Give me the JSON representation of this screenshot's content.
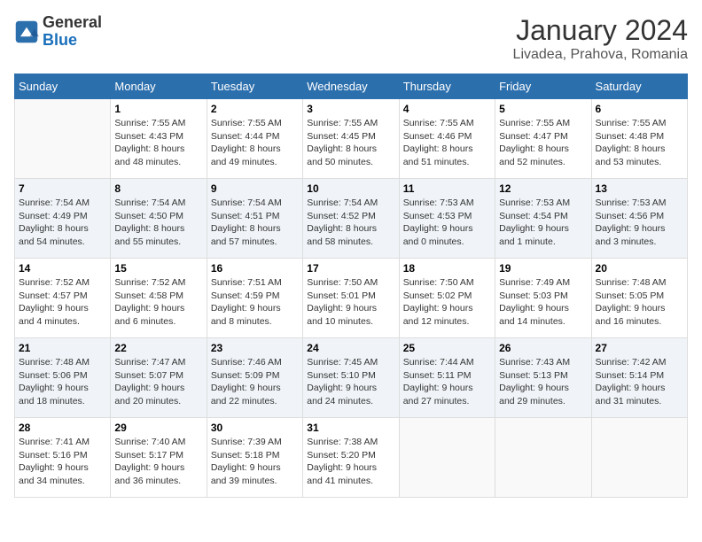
{
  "header": {
    "logo_line1": "General",
    "logo_line2": "Blue",
    "title": "January 2024",
    "subtitle": "Livadea, Prahova, Romania"
  },
  "days_of_week": [
    "Sunday",
    "Monday",
    "Tuesday",
    "Wednesday",
    "Thursday",
    "Friday",
    "Saturday"
  ],
  "weeks": [
    [
      {
        "day": "",
        "info": ""
      },
      {
        "day": "1",
        "info": "Sunrise: 7:55 AM\nSunset: 4:43 PM\nDaylight: 8 hours\nand 48 minutes."
      },
      {
        "day": "2",
        "info": "Sunrise: 7:55 AM\nSunset: 4:44 PM\nDaylight: 8 hours\nand 49 minutes."
      },
      {
        "day": "3",
        "info": "Sunrise: 7:55 AM\nSunset: 4:45 PM\nDaylight: 8 hours\nand 50 minutes."
      },
      {
        "day": "4",
        "info": "Sunrise: 7:55 AM\nSunset: 4:46 PM\nDaylight: 8 hours\nand 51 minutes."
      },
      {
        "day": "5",
        "info": "Sunrise: 7:55 AM\nSunset: 4:47 PM\nDaylight: 8 hours\nand 52 minutes."
      },
      {
        "day": "6",
        "info": "Sunrise: 7:55 AM\nSunset: 4:48 PM\nDaylight: 8 hours\nand 53 minutes."
      }
    ],
    [
      {
        "day": "7",
        "info": "Sunrise: 7:54 AM\nSunset: 4:49 PM\nDaylight: 8 hours\nand 54 minutes."
      },
      {
        "day": "8",
        "info": "Sunrise: 7:54 AM\nSunset: 4:50 PM\nDaylight: 8 hours\nand 55 minutes."
      },
      {
        "day": "9",
        "info": "Sunrise: 7:54 AM\nSunset: 4:51 PM\nDaylight: 8 hours\nand 57 minutes."
      },
      {
        "day": "10",
        "info": "Sunrise: 7:54 AM\nSunset: 4:52 PM\nDaylight: 8 hours\nand 58 minutes."
      },
      {
        "day": "11",
        "info": "Sunrise: 7:53 AM\nSunset: 4:53 PM\nDaylight: 9 hours\nand 0 minutes."
      },
      {
        "day": "12",
        "info": "Sunrise: 7:53 AM\nSunset: 4:54 PM\nDaylight: 9 hours\nand 1 minute."
      },
      {
        "day": "13",
        "info": "Sunrise: 7:53 AM\nSunset: 4:56 PM\nDaylight: 9 hours\nand 3 minutes."
      }
    ],
    [
      {
        "day": "14",
        "info": "Sunrise: 7:52 AM\nSunset: 4:57 PM\nDaylight: 9 hours\nand 4 minutes."
      },
      {
        "day": "15",
        "info": "Sunrise: 7:52 AM\nSunset: 4:58 PM\nDaylight: 9 hours\nand 6 minutes."
      },
      {
        "day": "16",
        "info": "Sunrise: 7:51 AM\nSunset: 4:59 PM\nDaylight: 9 hours\nand 8 minutes."
      },
      {
        "day": "17",
        "info": "Sunrise: 7:50 AM\nSunset: 5:01 PM\nDaylight: 9 hours\nand 10 minutes."
      },
      {
        "day": "18",
        "info": "Sunrise: 7:50 AM\nSunset: 5:02 PM\nDaylight: 9 hours\nand 12 minutes."
      },
      {
        "day": "19",
        "info": "Sunrise: 7:49 AM\nSunset: 5:03 PM\nDaylight: 9 hours\nand 14 minutes."
      },
      {
        "day": "20",
        "info": "Sunrise: 7:48 AM\nSunset: 5:05 PM\nDaylight: 9 hours\nand 16 minutes."
      }
    ],
    [
      {
        "day": "21",
        "info": "Sunrise: 7:48 AM\nSunset: 5:06 PM\nDaylight: 9 hours\nand 18 minutes."
      },
      {
        "day": "22",
        "info": "Sunrise: 7:47 AM\nSunset: 5:07 PM\nDaylight: 9 hours\nand 20 minutes."
      },
      {
        "day": "23",
        "info": "Sunrise: 7:46 AM\nSunset: 5:09 PM\nDaylight: 9 hours\nand 22 minutes."
      },
      {
        "day": "24",
        "info": "Sunrise: 7:45 AM\nSunset: 5:10 PM\nDaylight: 9 hours\nand 24 minutes."
      },
      {
        "day": "25",
        "info": "Sunrise: 7:44 AM\nSunset: 5:11 PM\nDaylight: 9 hours\nand 27 minutes."
      },
      {
        "day": "26",
        "info": "Sunrise: 7:43 AM\nSunset: 5:13 PM\nDaylight: 9 hours\nand 29 minutes."
      },
      {
        "day": "27",
        "info": "Sunrise: 7:42 AM\nSunset: 5:14 PM\nDaylight: 9 hours\nand 31 minutes."
      }
    ],
    [
      {
        "day": "28",
        "info": "Sunrise: 7:41 AM\nSunset: 5:16 PM\nDaylight: 9 hours\nand 34 minutes."
      },
      {
        "day": "29",
        "info": "Sunrise: 7:40 AM\nSunset: 5:17 PM\nDaylight: 9 hours\nand 36 minutes."
      },
      {
        "day": "30",
        "info": "Sunrise: 7:39 AM\nSunset: 5:18 PM\nDaylight: 9 hours\nand 39 minutes."
      },
      {
        "day": "31",
        "info": "Sunrise: 7:38 AM\nSunset: 5:20 PM\nDaylight: 9 hours\nand 41 minutes."
      },
      {
        "day": "",
        "info": ""
      },
      {
        "day": "",
        "info": ""
      },
      {
        "day": "",
        "info": ""
      }
    ]
  ]
}
